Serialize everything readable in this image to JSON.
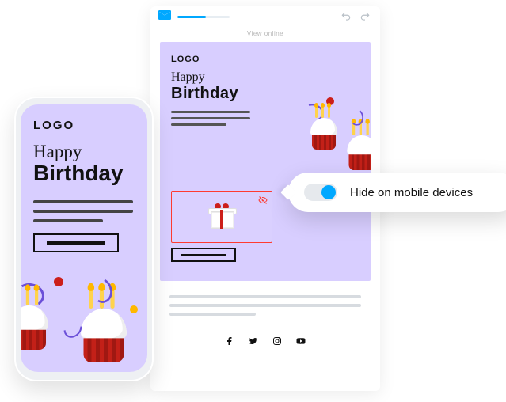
{
  "editor": {
    "view_online": "View online",
    "email": {
      "logo": "LOGO",
      "heading_line1": "Happy",
      "heading_line2": "Birthday"
    }
  },
  "phone": {
    "logo": "LOGO",
    "heading_line1": "Happy",
    "heading_line2": "Birthday"
  },
  "popover": {
    "label": "Hide on mobile devices",
    "toggle_on": true
  },
  "icons": {
    "envelope": "envelope-icon",
    "undo": "undo-icon",
    "redo": "redo-icon",
    "eye_off": "eye-off-icon",
    "facebook": "facebook-icon",
    "twitter": "twitter-icon",
    "instagram": "instagram-icon",
    "youtube": "youtube-icon"
  },
  "colors": {
    "accent": "#00a8ff",
    "canvas": "#d8ceff",
    "highlight": "#ff3b30"
  }
}
